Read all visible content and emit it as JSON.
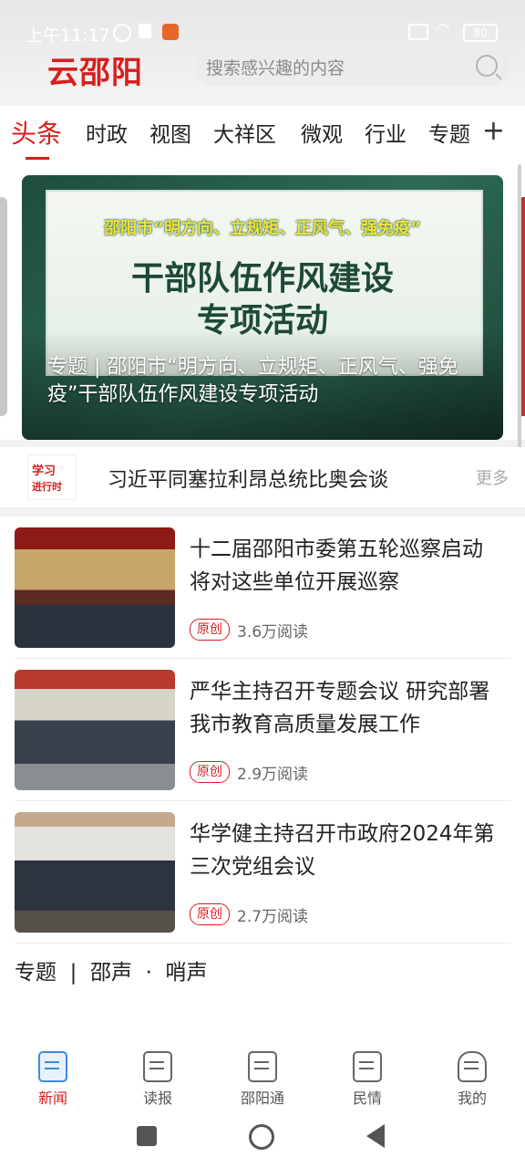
{
  "status_bar": {
    "time": "上午11:17",
    "battery": "80"
  },
  "header": {
    "logo": "云邵阳",
    "search_placeholder": "搜索感兴趣的内容"
  },
  "tabs": [
    "头条",
    "时政",
    "视图",
    "大祥区",
    "微观",
    "行业",
    "专题"
  ],
  "tabs_plus": "+",
  "banner": {
    "top_line": "邵阳市“明方向、立规矩、正风气、强免疫”",
    "title_line1": "干部队伍作风建设",
    "title_line2": "专项活动",
    "caption": "专题 | 邵阳市“明方向、立规矩、正风气、强免疫”干部队伍作风建设专项活动"
  },
  "study": {
    "logo_line1": "学习",
    "logo_line2": "进行时",
    "headline": "习近平同塞拉利昂总统比奥会谈",
    "more": "更多"
  },
  "news": [
    {
      "title": "十二届邵阳市委第五轮巡察启动 将对这些单位开展巡察",
      "badge": "原创",
      "reads": "3.6万阅读"
    },
    {
      "title": "严华主持召开专题会议 研究部署我市教育高质量发展工作",
      "badge": "原创",
      "reads": "2.9万阅读"
    },
    {
      "title": "华学健主持召开市政府2024年第三次党组会议",
      "badge": "原创",
      "reads": "2.7万阅读"
    }
  ],
  "topic_line": "专题  |  邵声  ·  哨声",
  "bottom_nav": [
    "新闻",
    "读报",
    "邵阳通",
    "民情",
    "我的"
  ],
  "colors": {
    "brand": "#d81e1e",
    "banner_green": "#2e6b56",
    "nav_blue": "#3f8ae0"
  }
}
